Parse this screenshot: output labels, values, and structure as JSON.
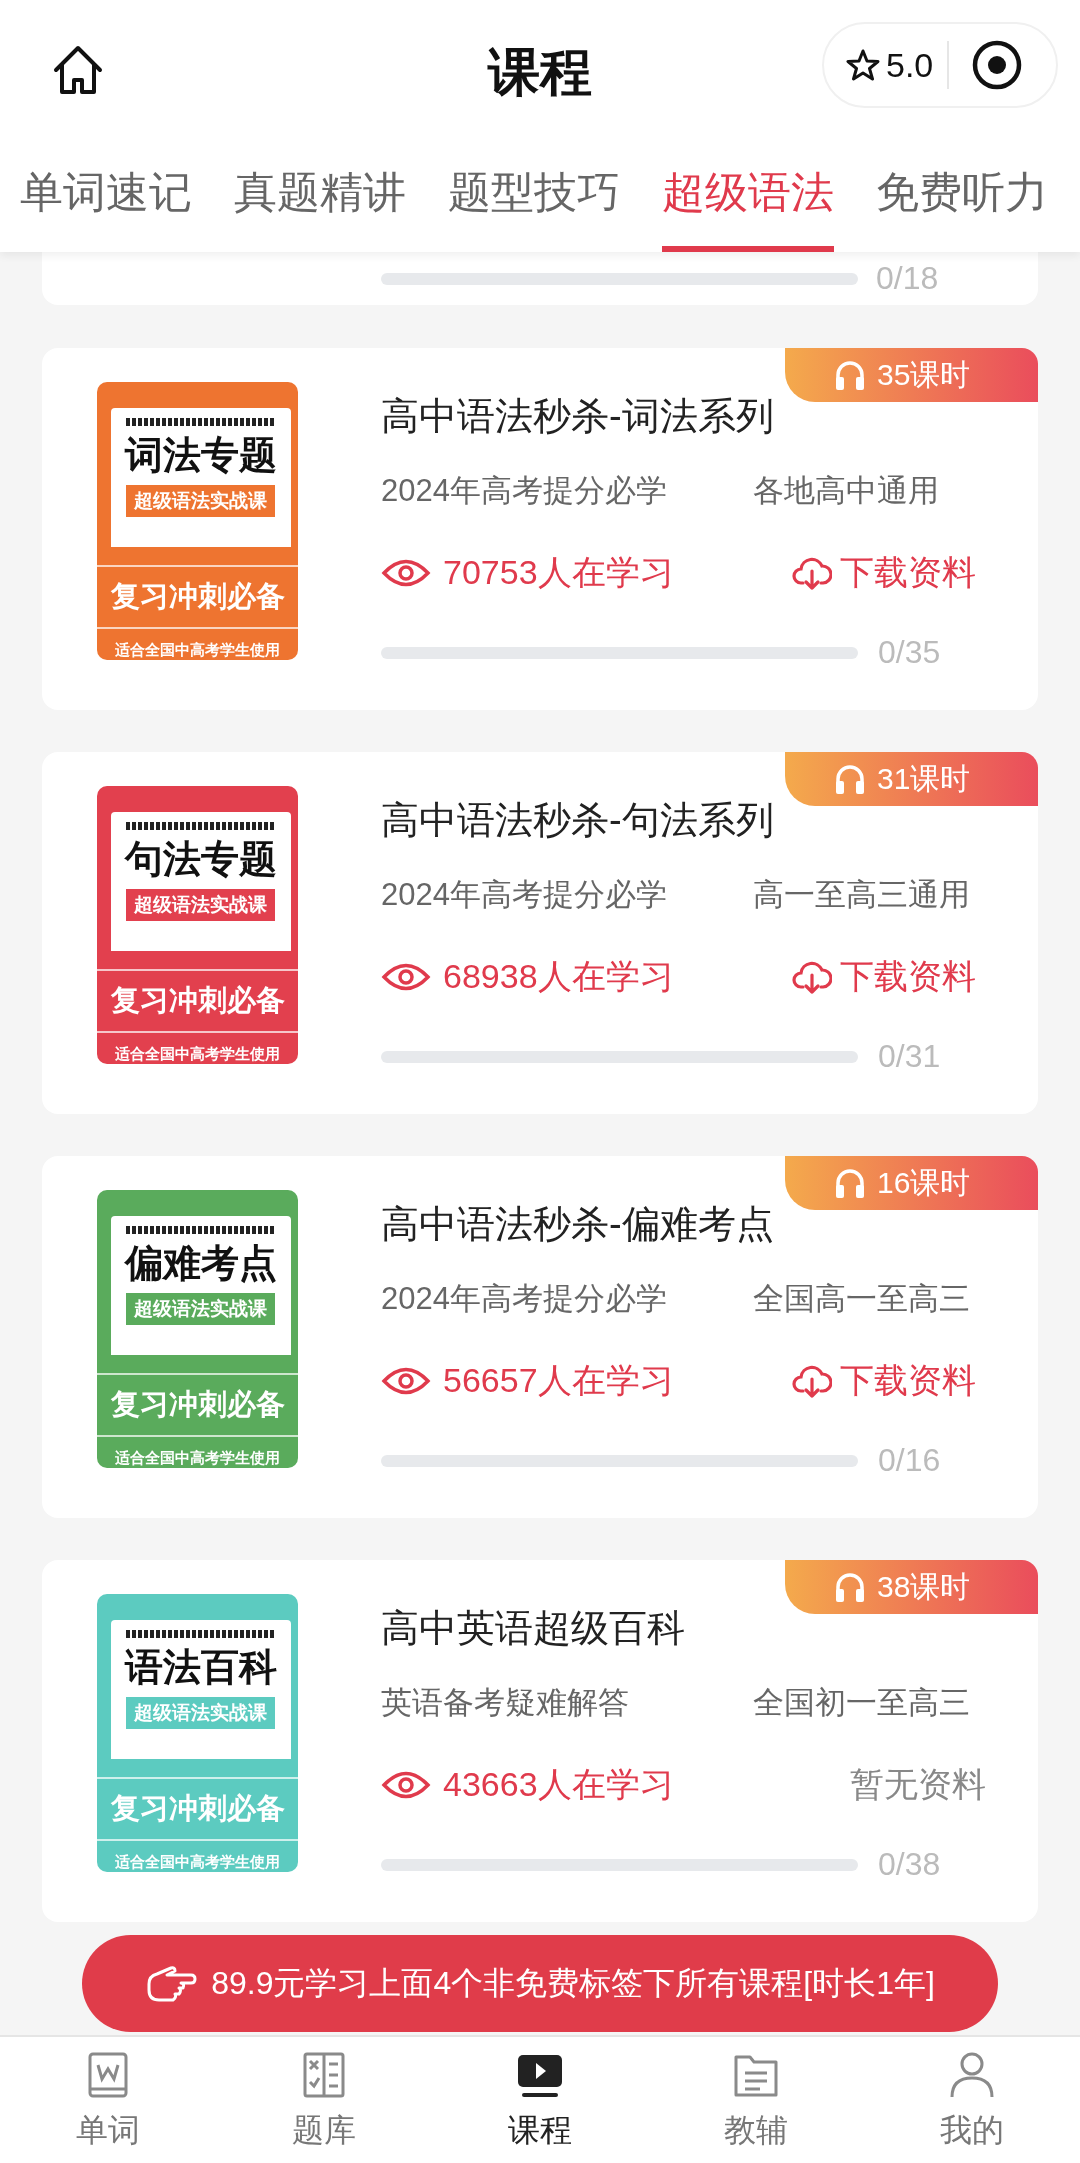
{
  "header": {
    "title": "课程",
    "rating": "5.0"
  },
  "tabs": [
    {
      "label": "单词速记",
      "selected": false
    },
    {
      "label": "真题精讲",
      "selected": false
    },
    {
      "label": "题型技巧",
      "selected": false
    },
    {
      "label": "超级语法",
      "selected": true
    },
    {
      "label": "免费听力",
      "selected": false
    }
  ],
  "partial_course": {
    "progress": "0/18",
    "level": 0
  },
  "courses": [
    {
      "badge": "35课时",
      "title": "高中语法秒杀-词法系列",
      "tags": [
        "2024年高考提分必学",
        "各地高中通用"
      ],
      "learners": "70753人在学习",
      "resource": {
        "kind": "download",
        "text": "下载资料"
      },
      "progress": "0/35",
      "level": 0,
      "cover": {
        "color": "#ee7430",
        "title": "词法专题",
        "subtitle": "超级语法实战课",
        "slogan": "复习冲刺必备",
        "note": "适合全国中高考学生使用"
      }
    },
    {
      "badge": "31课时",
      "title": "高中语法秒杀-句法系列",
      "tags": [
        "2024年高考提分必学",
        "高一至高三通用"
      ],
      "learners": "68938人在学习",
      "resource": {
        "kind": "download",
        "text": "下载资料"
      },
      "progress": "0/31",
      "level": 0,
      "cover": {
        "color": "#e2404e",
        "title": "句法专题",
        "subtitle": "超级语法实战课",
        "slogan": "复习冲刺必备",
        "note": "适合全国中高考学生使用"
      }
    },
    {
      "badge": "16课时",
      "title": "高中语法秒杀-偏难考点",
      "tags": [
        "2024年高考提分必学",
        "全国高一至高三"
      ],
      "learners": "56657人在学习",
      "resource": {
        "kind": "download",
        "text": "下载资料"
      },
      "progress": "0/16",
      "level": 0,
      "cover": {
        "color": "#5aab5c",
        "title": "偏难考点",
        "subtitle": "超级语法实战课",
        "slogan": "复习冲刺必备",
        "note": "适合全国中高考学生使用"
      }
    },
    {
      "badge": "38课时",
      "title": "高中英语超级百科",
      "tags": [
        "英语备考疑难解答",
        "全国初一至高三"
      ],
      "learners": "43663人在学习",
      "resource": {
        "kind": "none",
        "text": "暂无资料"
      },
      "progress": "0/38",
      "level": 0,
      "cover": {
        "color": "#5ccbc0",
        "title": "语法百科",
        "subtitle": "超级语法实战课",
        "slogan": "复习冲刺必备",
        "note": "适合全国中高考学生使用"
      }
    }
  ],
  "promo_button": "89.9元学习上面4个非免费标签下所有课程[时长1年]",
  "bottom_nav": [
    {
      "label": "单词",
      "selected": false
    },
    {
      "label": "题库",
      "selected": false
    },
    {
      "label": "课程",
      "selected": true
    },
    {
      "label": "教辅",
      "selected": false
    },
    {
      "label": "我的",
      "selected": false
    }
  ]
}
